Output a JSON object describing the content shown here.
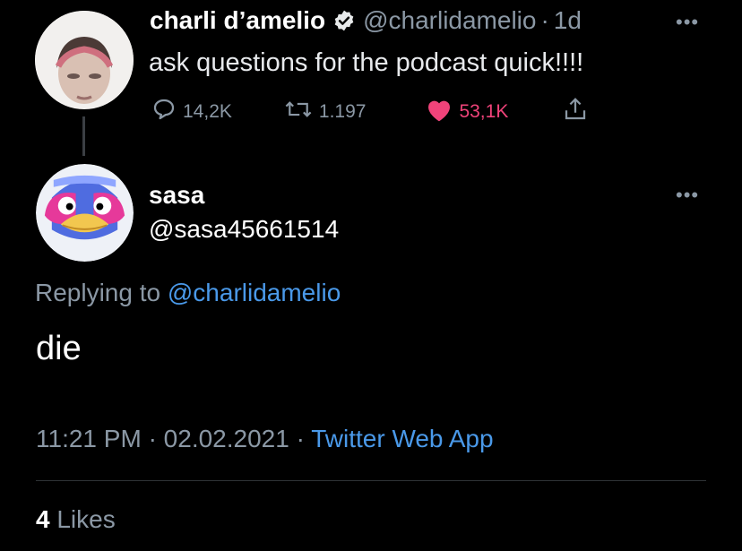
{
  "parent_tweet": {
    "display_name": "charli d’amelio",
    "handle": "@charlidamelio",
    "separator": "·",
    "time_ago": "1d",
    "text": "ask questions for the podcast quick!!!!",
    "actions": {
      "replies": "14,2K",
      "retweets": "1.197",
      "likes": "53,1K"
    },
    "icons": [
      "verified-badge-icon",
      "reply-icon",
      "retweet-icon",
      "like-icon",
      "share-icon",
      "more-icon"
    ],
    "colors": {
      "like": "#f0437a",
      "link": "#4a99e9",
      "muted": "#8b98a5"
    }
  },
  "reply_tweet": {
    "display_name": "sasa",
    "handle": "@sasa45661514",
    "replying_prefix": "Replying to",
    "replying_handle": "@charlidamelio",
    "text": "die",
    "time": "11:21 PM",
    "dot1": "·",
    "date": "02.02.2021",
    "dot2": "·",
    "source": "Twitter Web App",
    "likes_count": "4",
    "likes_label": "Likes"
  }
}
